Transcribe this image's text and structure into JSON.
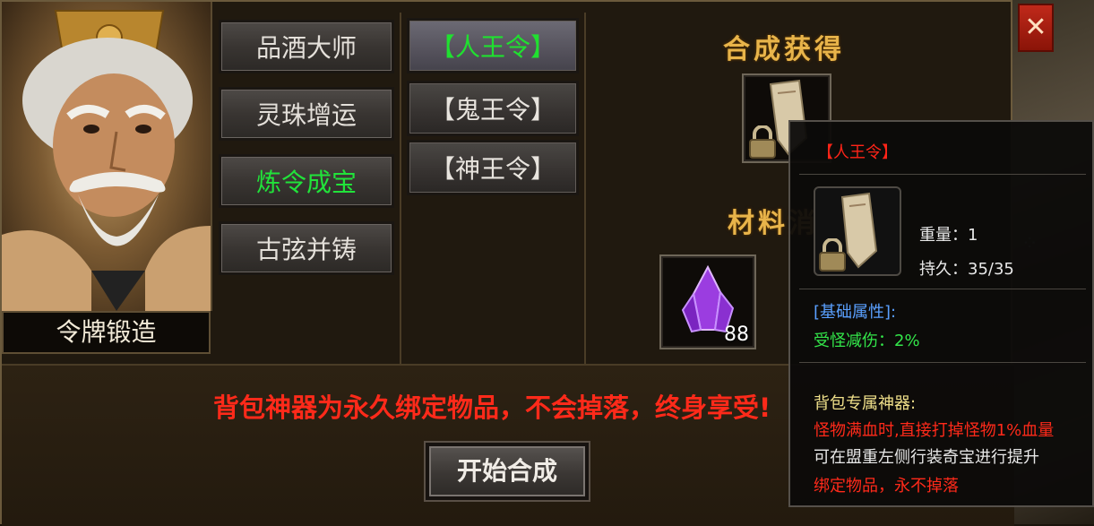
{
  "npc": {
    "name": "令牌锻造"
  },
  "menu": {
    "items": [
      {
        "label": "品酒大师",
        "active": false
      },
      {
        "label": "灵珠增运",
        "active": false
      },
      {
        "label": "炼令成宝",
        "active": true
      },
      {
        "label": "古弦并铸",
        "active": false
      }
    ]
  },
  "submenu": {
    "items": [
      {
        "label": "【人王令】",
        "active": true
      },
      {
        "label": "【鬼王令】",
        "active": false
      },
      {
        "label": "【神王令】",
        "active": false
      }
    ]
  },
  "synthesis": {
    "result_title": "合成获得",
    "material_title": "材料消",
    "material_count": "88"
  },
  "notice": "背包神器为永久绑定物品，不会掉落，终身享受!",
  "start_button": "开始合成",
  "close_button": "✕",
  "tooltip": {
    "item_name": "【人王令】",
    "weight": "重量：1",
    "durability": "持久：35/35",
    "base_attr_header": "[基础属性]:",
    "base_attr": "受怪减伤：2%",
    "special_header": "背包专属神器:",
    "special_line1": "怪物满血时,直接打掉怪物1%血量",
    "special_line2": "可在盟重左侧行装奇宝进行提升",
    "special_line3": "绑定物品，永不掉落"
  },
  "colors": {
    "active_green": "#21e33a",
    "notice_red": "#ff2a1a",
    "title_gold": "#e8b44a",
    "attr_blue": "#5aa0ff"
  }
}
